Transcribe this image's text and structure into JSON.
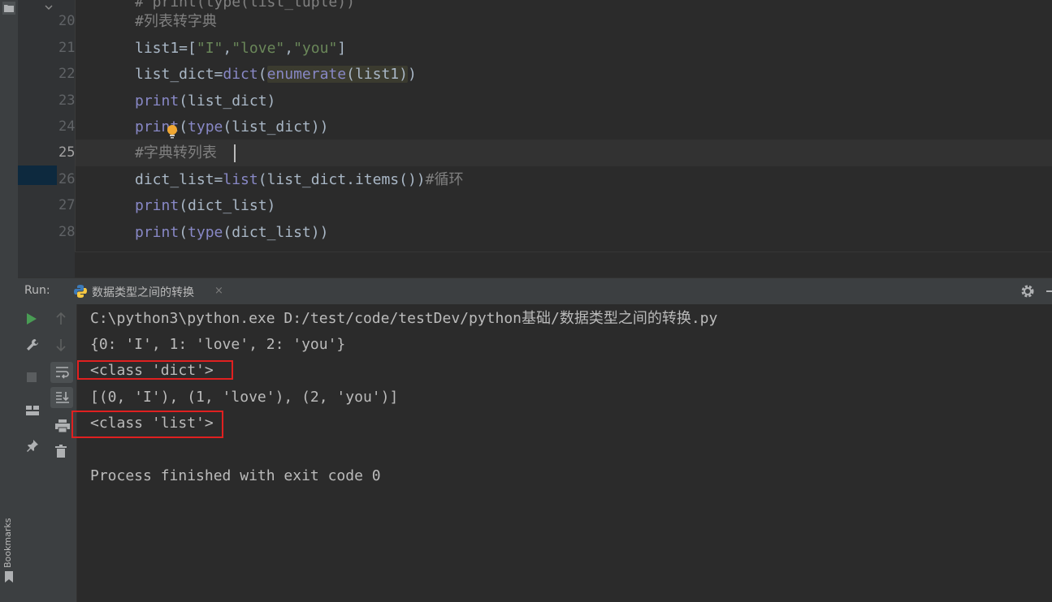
{
  "editor": {
    "top_partial_line": "# print(type(list_tuple))",
    "lines": [
      {
        "no": "20",
        "text": "#列表转字典"
      },
      {
        "no": "21",
        "text": "list1=[\"I\",\"love\",\"you\"]"
      },
      {
        "no": "22",
        "text": "list_dict=dict(enumerate(list1))"
      },
      {
        "no": "23",
        "text": "print(list_dict)"
      },
      {
        "no": "24",
        "text": "print(type(list_dict))"
      },
      {
        "no": "25",
        "text": "#字典转列表"
      },
      {
        "no": "26",
        "text": "dict_list=list(list_dict.items())#循环"
      },
      {
        "no": "27",
        "text": "print(dict_list)"
      },
      {
        "no": "28",
        "text": "print(type(dict_list))"
      }
    ],
    "active_line": "25"
  },
  "run_panel": {
    "label": "Run:",
    "tab_title": "数据类型之间的转换",
    "tab_close": "×"
  },
  "console": {
    "lines": [
      "C:\\python3\\python.exe D:/test/code/testDev/python基础/数据类型之间的转换.py",
      "{0: 'I', 1: 'love', 2: 'you'}",
      "<class 'dict'>",
      "[(0, 'I'), (1, 'love'), (2, 'you')]",
      "<class 'list'>",
      "",
      "Process finished with exit code 0"
    ]
  },
  "left_strip": {
    "bookmarks_label": "Bookmarks"
  },
  "colors": {
    "editor_bg": "#2b2b2b",
    "gutter_bg": "#313335",
    "panel_bg": "#3c3f41",
    "builtin": "#8888c6",
    "string": "#6a8759",
    "comment": "#808080",
    "text": "#a9b7c6",
    "highlight_box": "#e02020",
    "run_green": "#499c54"
  }
}
